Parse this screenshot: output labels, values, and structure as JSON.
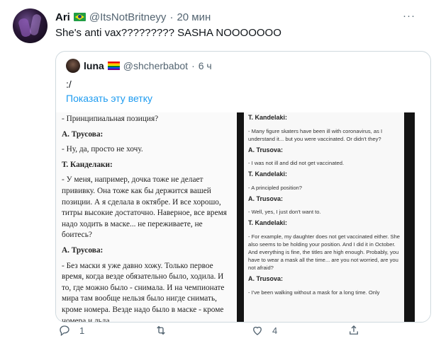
{
  "tweet": {
    "name": "Ari",
    "handle": "@ItsNotBritneyy",
    "separator": "·",
    "time": "20 мин",
    "more": "···",
    "text": "She's anti vax????????? SASHA NOOOOOOO"
  },
  "quoted": {
    "name": "luna",
    "handle": "@shcherbabot",
    "separator": "·",
    "time": "6 ч",
    "text": ":/",
    "thread_link": "Показать эту ветку",
    "image_left": [
      {
        "kind": "line",
        "text": "- Принципиальная позиция?"
      },
      {
        "kind": "speaker",
        "text": "А. Трусова:"
      },
      {
        "kind": "line",
        "text": "- Ну, да, просто не хочу."
      },
      {
        "kind": "speaker",
        "text": "Т. Канделаки:"
      },
      {
        "kind": "line",
        "text": "- У меня, например, дочка тоже не делает прививку. Она тоже как бы держится вашей позиции. А я сделала в октябре. И все хорошо, титры высокие достаточно. Наверное, все время надо ходить в маске... не переживаете, не боитесь?"
      },
      {
        "kind": "speaker",
        "text": "А. Трусова:"
      },
      {
        "kind": "line",
        "text": "- Без маски я уже давно хожу. Только первое время, когда везде обязательно было, ходила. И то, где можно было - снимала. И на чемпионате мира там вообще нельзя было нигде снимать, кроме номера. Везде надо было в маске - кроме номера и льда."
      }
    ],
    "image_right": [
      {
        "kind": "speaker",
        "text": "T. Kandelaki:"
      },
      {
        "kind": "line",
        "text": "- Many figure skaters have been ill with coronavirus, as I understand it... but you were vaccinated. Or didn't they?"
      },
      {
        "kind": "speaker",
        "text": "A. Trusova:"
      },
      {
        "kind": "line",
        "text": "- I was not ill and did not get vaccinated."
      },
      {
        "kind": "speaker",
        "text": "T. Kandelaki:"
      },
      {
        "kind": "line",
        "text": "- A principled position?"
      },
      {
        "kind": "speaker",
        "text": "A. Trusova:"
      },
      {
        "kind": "line",
        "text": "- Well, yes, I just don't want to."
      },
      {
        "kind": "speaker",
        "text": "T. Kandelaki:"
      },
      {
        "kind": "line",
        "text": "- For example, my daughter does not get vaccinated either. She also seems to be holding your position. And I did it in October. And everything is fine, the titles are high enough. Probably, you have to wear a mask all the time... are you not worried, are you not afraid?"
      },
      {
        "kind": "speaker",
        "text": "A. Trusova:"
      },
      {
        "kind": "line",
        "text": "- I've been walking without a mask for a long time. Only"
      }
    ]
  },
  "actions": {
    "reply_count": "1",
    "retweet_count": "",
    "like_count": "4"
  },
  "colors": {
    "link": "#1d9bf0",
    "secondary_text": "#536471",
    "border": "#cfd9de"
  }
}
